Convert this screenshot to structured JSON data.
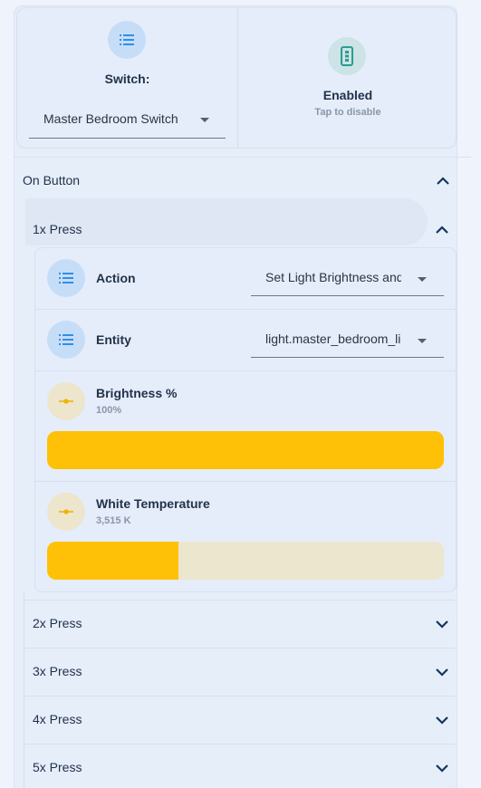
{
  "switch_card": {
    "label": "Switch:",
    "selected": "Master Bedroom Switch",
    "icon": "list-icon"
  },
  "enable_card": {
    "title": "Enabled",
    "subtitle": "Tap to disable",
    "icon": "switch-device-icon"
  },
  "on_button": {
    "label": "On Button",
    "expanded": true
  },
  "presses": [
    {
      "label": "1x Press",
      "expanded": true
    },
    {
      "label": "2x Press",
      "expanded": false
    },
    {
      "label": "3x Press",
      "expanded": false
    },
    {
      "label": "4x Press",
      "expanded": false
    },
    {
      "label": "5x Press",
      "expanded": false
    }
  ],
  "action": {
    "label": "Action",
    "value": "Set Light Brightness and Temperature"
  },
  "entity": {
    "label": "Entity",
    "value": "light.master_bedroom_light"
  },
  "brightness": {
    "label": "Brightness %",
    "value_text": "100%",
    "fraction": 1.0
  },
  "temperature": {
    "label": "White Temperature",
    "value_text": "3,515 K",
    "fraction": 0.33
  },
  "colors": {
    "accent_blue": "#2f8fe6",
    "slider_fill": "#ffc107",
    "slider_track": "#ece6cf",
    "chevron": "#14365e",
    "enabled_icon": "#2a9d8f"
  }
}
